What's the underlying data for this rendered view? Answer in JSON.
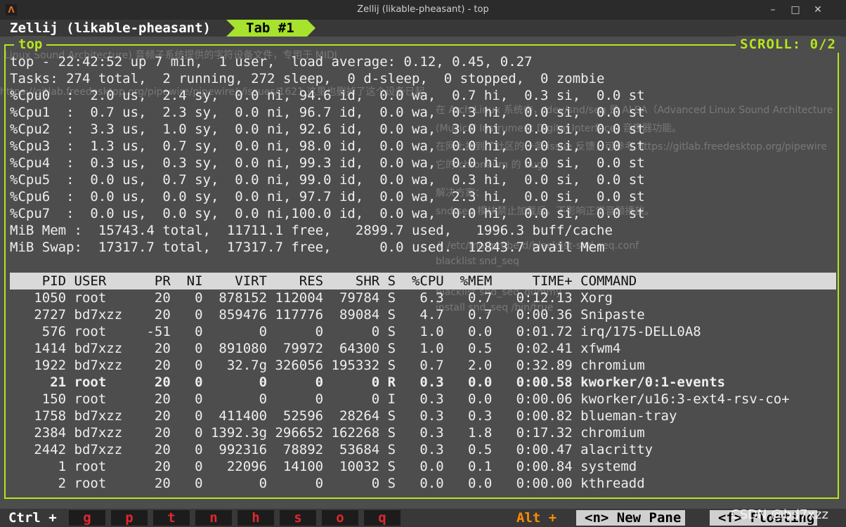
{
  "window": {
    "title": "Zellij (likable-pheasant) - top",
    "minimize_glyph": "–",
    "maximize_glyph": "□",
    "close_glyph": "✕"
  },
  "tabbar": {
    "session": "Zellij (likable-pheasant)",
    "active_tab": "Tab #1"
  },
  "pane": {
    "title": "top",
    "scroll": "SCROLL:  0/2"
  },
  "top": {
    "summary": [
      "top - 22:42:52 up 7 min,  1 user,  load average: 0.12, 0.45, 0.27",
      "Tasks: 274 total,  2 running, 272 sleep,  0 d-sleep,  0 stopped,  0 zombie"
    ],
    "cpus": [
      "%Cpu0  :  2.0 us,  2.4 sy,  0.0 ni, 94.6 id,  0.0 wa,  0.7 hi,  0.3 si,  0.0 st",
      "%Cpu1  :  0.7 us,  2.3 sy,  0.0 ni, 96.7 id,  0.0 wa,  0.3 hi,  0.0 si,  0.0 st",
      "%Cpu2  :  3.3 us,  1.0 sy,  0.0 ni, 92.6 id,  0.0 wa,  3.0 hi,  0.0 si,  0.0 st",
      "%Cpu3  :  1.3 us,  0.7 sy,  0.0 ni, 98.0 id,  0.0 wa,  0.0 hi,  0.0 si,  0.0 st",
      "%Cpu4  :  0.3 us,  0.3 sy,  0.0 ni, 99.3 id,  0.0 wa,  0.0 hi,  0.0 si,  0.0 st",
      "%Cpu5  :  0.0 us,  0.7 sy,  0.0 ni, 99.0 id,  0.0 wa,  0.3 hi,  0.0 si,  0.0 st",
      "%Cpu6  :  0.0 us,  0.0 sy,  0.0 ni, 97.7 id,  0.0 wa,  2.3 hi,  0.0 si,  0.0 st",
      "%Cpu7  :  0.0 us,  0.0 sy,  0.0 ni,100.0 id,  0.0 wa,  0.0 hi,  0.0 si,  0.0 st"
    ],
    "mem": "MiB Mem :  15743.4 total,  11711.1 free,   2899.7 used,   1996.3 buff/cache",
    "swap": "MiB Swap:  17317.7 total,  17317.7 free,      0.0 used.  12843.7 avail Mem",
    "header": "    PID USER      PR  NI    VIRT    RES    SHR S  %CPU  %MEM     TIME+ COMMAND",
    "processes": [
      {
        "text": "   1050 root      20   0  878152 112004  79784 S   6.3   0.7   0:12.13 Xorg",
        "bold": false
      },
      {
        "text": "   2727 bd7xzz    20   0  859476 117776  89084 S   4.7   0.7   0:00.36 Snipaste",
        "bold": false
      },
      {
        "text": "    576 root     -51   0       0      0      0 S   1.0   0.0   0:01.72 irq/175-DELL0A8",
        "bold": false
      },
      {
        "text": "   1414 bd7xzz    20   0  891080  79972  64300 S   1.0   0.5   0:02.41 xfwm4",
        "bold": false
      },
      {
        "text": "   1922 bd7xzz    20   0   32.7g 326056 195332 S   0.7   2.0   0:32.89 chromium",
        "bold": false
      },
      {
        "text": "     21 root      20   0       0      0      0 R   0.3   0.0   0:00.58 kworker/0:1-events",
        "bold": true
      },
      {
        "text": "    150 root      20   0       0      0      0 I   0.3   0.0   0:00.06 kworker/u16:3-ext4-rsv-co+",
        "bold": false
      },
      {
        "text": "   1758 bd7xzz    20   0  411400  52596  28264 S   0.3   0.3   0:00.82 blueman-tray",
        "bold": false
      },
      {
        "text": "   2384 bd7xzz    20   0 1392.3g 296652 162268 S   0.3   1.8   0:17.32 chromium",
        "bold": false
      },
      {
        "text": "   2442 bd7xzz    20   0  992316  78892  53684 S   0.3   0.5   0:00.47 alacritty",
        "bold": false
      },
      {
        "text": "      1 root      20   0   22096  14100  10032 S   0.0   0.1   0:00.84 systemd",
        "bold": false
      },
      {
        "text": "      2 root      20   0       0      0      0 S   0.0   0.0   0:00.00 kthreadd",
        "bold": false
      }
    ]
  },
  "ghost": {
    "line1": "Linux Sound Architecture) 音频子系统提供的字符设备文件，专用于 MIDI",
    "line2": "https://gitlab.freedesktop.org/pipewire/pipewire/-/issues/1621 这里也删掉了这个设备已起",
    "right": [
      "在 Arch Linux 系统中，/dev/snd/seq 是 ALSA（Advanced Linux Sound Architecture",
      "(Musical Instrument Digital Interface) 音序器功能。",
      "在网上找到了社区的一条 issue 反馈，可参考 https://gitlab.freedesktop.org/pipewire",
      "它的 chromium 的 bug。",
      "解决方案：",
      "snd-seq 模块禁止加载后，不影响正常音频播放。",
      "# /etc/modprobe.d/blacklist-snd-seq.conf",
      "blacklist snd_seq",
      "blacklist snd_seq_dummy",
      "install snd_seq /bin/true"
    ]
  },
  "statusbar": {
    "ctrl_label": "Ctrl +",
    "keys": [
      "g",
      "p",
      "t",
      "n",
      "h",
      "s",
      "o",
      "q"
    ],
    "alt_label": "Alt +",
    "new_pane": "<n> New Pane",
    "floating": "<f> Floating"
  },
  "watermark": "CSDN @bd7xzz",
  "colors": {
    "accent": "#b5e61d",
    "tab_active": "#a6e22e",
    "key_red": "#e0282e",
    "alt_orange": "#ff8c00"
  }
}
